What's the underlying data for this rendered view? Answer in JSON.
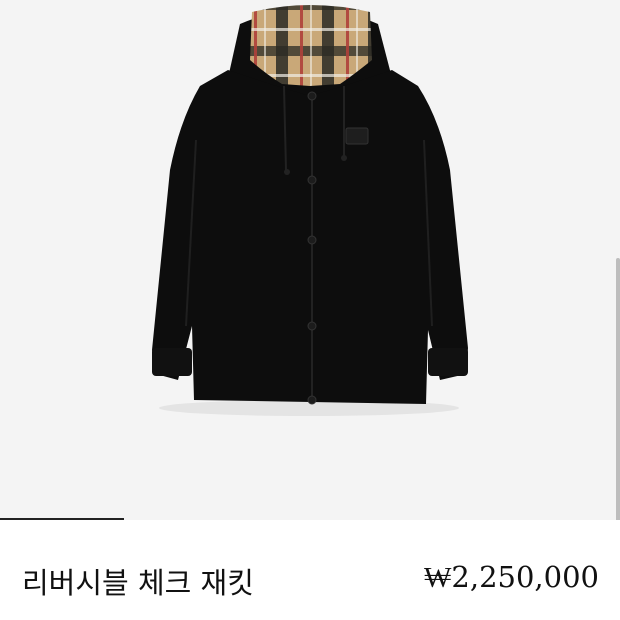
{
  "product": {
    "name": "리버시블 체크 재킷",
    "price": "₩2,250,000",
    "image_subject": "jacket-image"
  },
  "carousel": {
    "active_index": 1,
    "total_indicated": 5
  },
  "colors": {
    "background": "#f4f4f4",
    "jacket": "#0d0d0d",
    "check_beige": "#c9a878",
    "check_red": "#b0413a",
    "check_dark": "#2a2a24"
  }
}
